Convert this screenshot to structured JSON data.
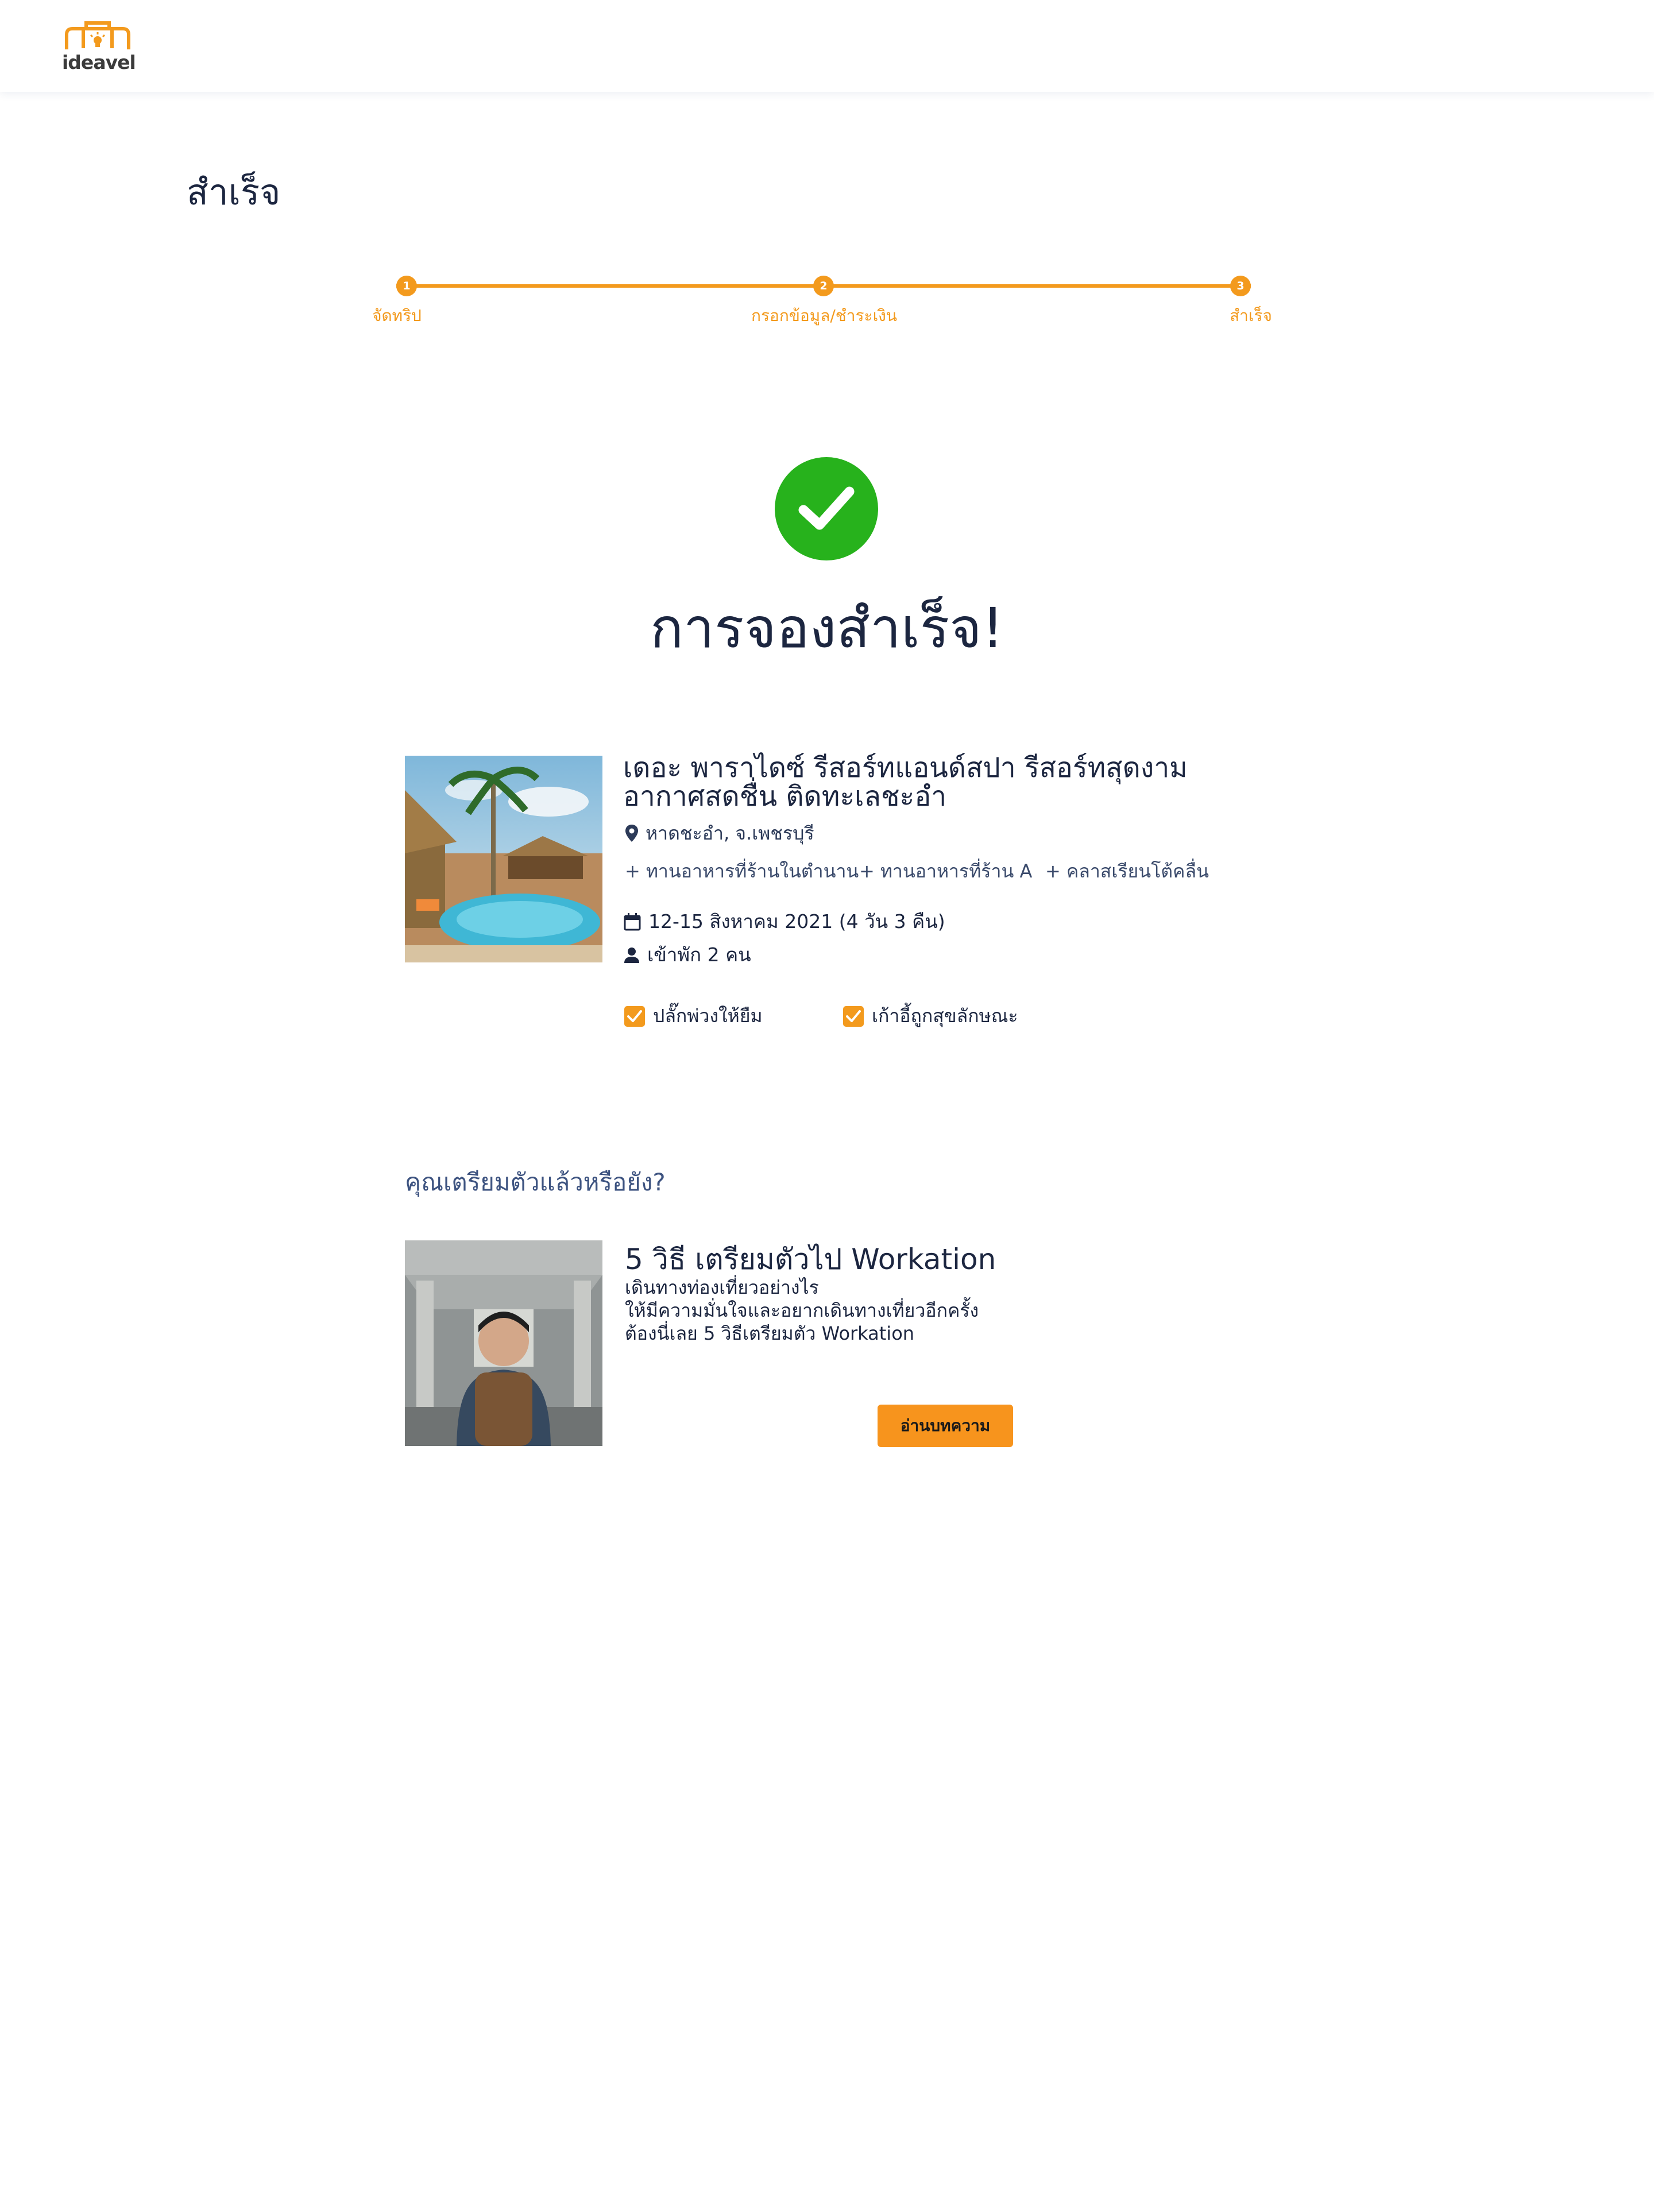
{
  "header": {
    "logo_text": "ideavel",
    "logo_icon": "suitcase-lightbulb-icon",
    "brand_color": "#f39a1d"
  },
  "page": {
    "title": "สำเร็จ"
  },
  "stepper": {
    "steps": [
      {
        "number": "1",
        "label": "จัดทริป"
      },
      {
        "number": "2",
        "label": "กรอกข้อมูล/ชำระเงิน"
      },
      {
        "number": "3",
        "label": "สำเร็จ"
      }
    ],
    "color": "#f39a1d"
  },
  "success": {
    "icon": "check-circle-icon",
    "title": "การจองสำเร็จ!",
    "color": "#27b21c"
  },
  "booking": {
    "image": "resort-pool-photo",
    "name_line1": "เดอะ พาราไดซ์ รีสอร์ทแอนด์สปา รีสอร์ทสุดงาม",
    "name_line2": "อากาศสดชื่น ติดทะเลชะอำ",
    "location": "หาดชะอำ, จ.เพชรบุรี",
    "addons": [
      "ทานอาหารที่ร้านในตำนาน",
      "ทานอาหารที่ร้าน A",
      "คลาสเรียนโต้คลื่น"
    ],
    "dates": "12-15 สิงหาคม 2021 (4 วัน 3 คืน)",
    "guests": "เข้าพัก 2 คน",
    "options": [
      {
        "label": "ปลั๊กพ่วงให้ยืม",
        "checked": true
      },
      {
        "label": "เก้าอี้ถูกสุขลักษณะ",
        "checked": true
      }
    ]
  },
  "prep": {
    "title": "คุณเตรียมตัวแล้วหรือยัง?",
    "article": {
      "image": "backpacker-tunnel-photo",
      "title": "5 วิธี เตรียมตัวไป Workation",
      "desc_line1": "เดินทางท่องเที่ยวอย่างไร",
      "desc_line2": "ให้มีความมั่นใจและอยากเดินทางเที่ยวอีกครั้ง",
      "desc_line3": "ต้องนี่เลย 5 วิธีเตรียมตัว Workation",
      "button_label": "อ่านบทความ"
    }
  }
}
